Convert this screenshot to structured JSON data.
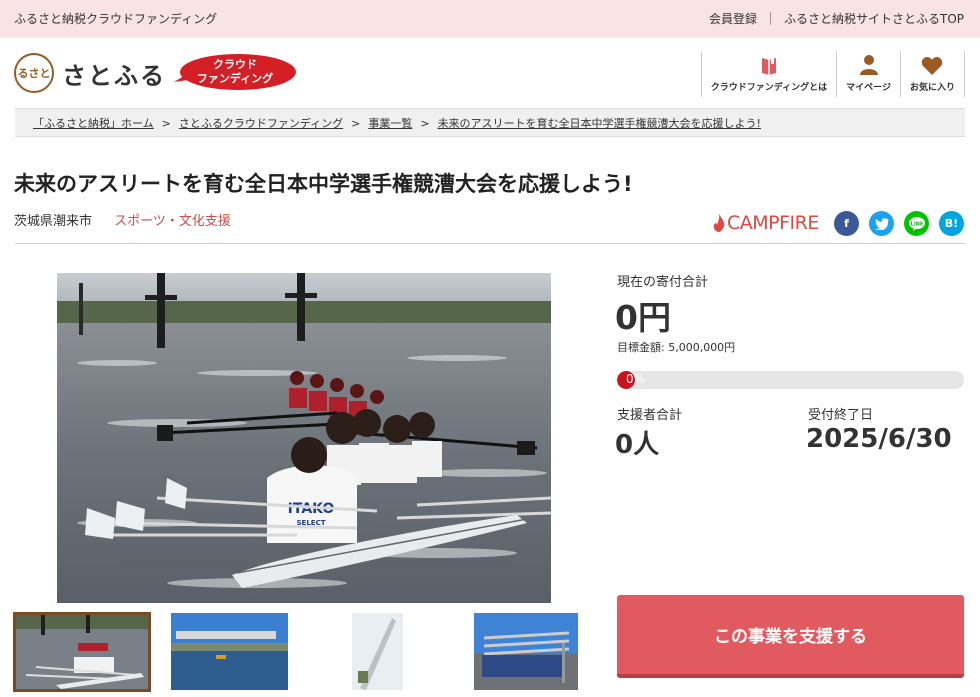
{
  "topbar": {
    "tagline": "ふるさと納税クラウドファンディング",
    "member_register": "会員登録",
    "site_top": "ふるさと納税サイトさとふるTOP"
  },
  "header": {
    "logo_text": "さとふる",
    "logo_mark": "るさと",
    "badge_line1": "クラウド",
    "badge_line2": "ファンディング",
    "nav": [
      {
        "label": "クラウドファンディングとは",
        "icon": "book-icon"
      },
      {
        "label": "マイページ",
        "icon": "person-icon"
      },
      {
        "label": "お気に入り",
        "icon": "heart-icon"
      }
    ]
  },
  "breadcrumb": [
    "「ふるさと納税」ホーム",
    "さとふるクラウドファンディング",
    "事業一覧",
    "未来のアスリートを育む全日本中学選手権競漕大会を応援しよう!"
  ],
  "breadcrumb_sep": ">",
  "project": {
    "title": "未来のアスリートを育む全日本中学選手権競漕大会を応援しよう!",
    "prefecture": "茨城県潮来市",
    "category": "スポーツ・文化支援",
    "partner": "CAMPFIRE",
    "shirt_text_1": "ITAKO",
    "shirt_text_2": "SELECT"
  },
  "social": [
    {
      "name": "facebook",
      "glyph": "f",
      "color": "#3b5998"
    },
    {
      "name": "twitter",
      "glyph": "t",
      "color": "#1da1f2"
    },
    {
      "name": "line",
      "glyph": "L",
      "color": "#00c300"
    },
    {
      "name": "hatena",
      "glyph": "B!",
      "color": "#00a4de"
    }
  ],
  "stats": {
    "total_label": "現在の寄付合計",
    "total_value": "0円",
    "goal_text": "目標金額: 5,000,000円",
    "progress_text": "0%",
    "progress_fraction": 0,
    "supporters_label": "支援者合計",
    "supporters_value": "0人",
    "deadline_label": "受付終了日",
    "deadline_value": "2025/6/30"
  },
  "cta": {
    "label": "この事業を支援する"
  },
  "colors": {
    "accent": "#e05a5f",
    "brand": "#7d4a1f",
    "category": "#d14b4b",
    "progress": "#c9141e"
  }
}
